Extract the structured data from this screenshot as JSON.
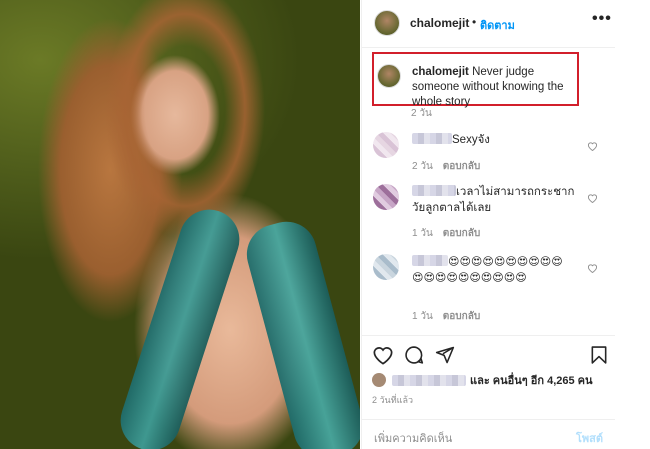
{
  "post": {
    "username": "chalomejit",
    "header_separator": "•",
    "follow_label": "ติดตาม",
    "more_label": "•••"
  },
  "caption": {
    "username": "chalomejit",
    "text": "Never judge someone without knowing the whole story",
    "time": "2 วัน"
  },
  "comments": [
    {
      "text": "Sexyจัง",
      "time": "2 วัน",
      "reply_label": "ตอบกลับ"
    },
    {
      "text": "เวลาไม่สามารถกระชากวัยลูกตาลได้เลย",
      "time": "1 วัน",
      "reply_label": "ตอบกลับ"
    },
    {
      "text": "😍😍😍😍😍😍😍😍😍😍😍😍😍😍😍😍😍😍😍😍",
      "time": "1 วัน",
      "reply_label": "ตอบกลับ"
    }
  ],
  "likes": {
    "text": "และ คนอื่นๆ อีก 4,265 คน"
  },
  "post_time": "2 วันที่แล้ว",
  "comment_box": {
    "placeholder": "เพิ่มความคิดเห็น",
    "post_label": "โพสต์"
  },
  "icons": {
    "like": "heart-icon",
    "comment": "comment-icon",
    "share": "share-icon",
    "save": "bookmark-icon",
    "comment_like": "heart-icon"
  },
  "colors": {
    "follow_blue": "#0095f6",
    "highlight_red": "#d21f2b",
    "muted_text": "#8e8e8e",
    "post_disabled": "#b2dffc"
  }
}
